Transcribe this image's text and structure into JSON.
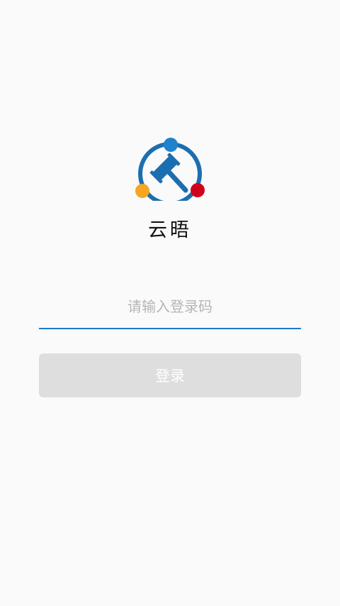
{
  "app": {
    "name": "云晤"
  },
  "login": {
    "code_placeholder": "请输入登录码",
    "code_value": "",
    "submit_label": "登录"
  },
  "colors": {
    "brand_blue": "#1b6fb0",
    "dot_blue": "#1f82cc",
    "dot_orange": "#f5a623",
    "dot_red": "#d0021b",
    "input_underline": "#1a7ccc",
    "button_disabled": "#dedede"
  },
  "icons": {
    "logo": "gavel-in-ring-icon"
  }
}
